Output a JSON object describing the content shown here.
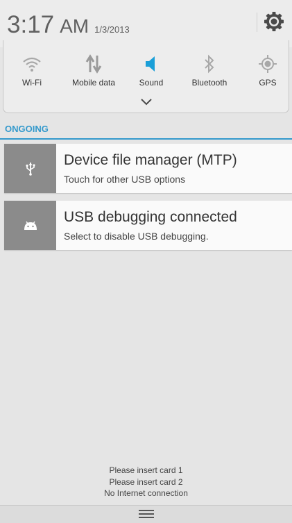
{
  "header": {
    "time": "3:17",
    "ampm": "AM",
    "date": "1/3/2013",
    "settings_icon": "gear-icon"
  },
  "quick_settings": {
    "toggles": [
      {
        "label": "Wi-Fi",
        "icon": "wifi-icon",
        "active": false
      },
      {
        "label": "Mobile data",
        "icon": "mobile-data-icon",
        "active": false
      },
      {
        "label": "Sound",
        "icon": "sound-icon",
        "active": true
      },
      {
        "label": "Bluetooth",
        "icon": "bluetooth-icon",
        "active": false
      },
      {
        "label": "GPS",
        "icon": "gps-icon",
        "active": false
      }
    ],
    "expand_icon": "chevron-down-icon",
    "active_color": "#1a9fd8",
    "inactive_color": "#a8a8a8"
  },
  "ongoing": {
    "section_label": "ONGOING",
    "accent": "#3399cc",
    "notifications": [
      {
        "title": "Device file manager (MTP)",
        "subtitle": "Touch for other USB options",
        "icon": "usb-icon"
      },
      {
        "title": "USB debugging connected",
        "subtitle": "Select to disable USB debugging.",
        "icon": "android-icon"
      }
    ]
  },
  "status_lines": [
    "Please insert card 1",
    "Please insert card 2",
    "No Internet connection"
  ],
  "handle_icon": "menu-icon"
}
